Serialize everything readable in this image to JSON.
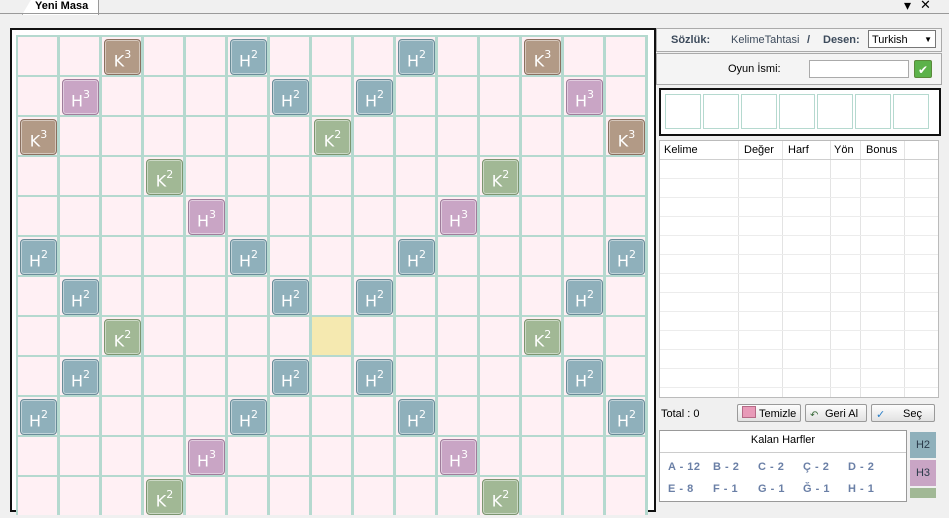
{
  "window": {
    "tab_title": "Yeni Masa",
    "menu_arrow": "▾",
    "close": "✕"
  },
  "board": {
    "size": 15,
    "center": [
      7,
      7
    ],
    "bonuses": [
      {
        "r": 0,
        "c": 2,
        "t": "K",
        "n": "3"
      },
      {
        "r": 0,
        "c": 5,
        "t": "H",
        "n": "2"
      },
      {
        "r": 0,
        "c": 9,
        "t": "H",
        "n": "2"
      },
      {
        "r": 0,
        "c": 12,
        "t": "K",
        "n": "3"
      },
      {
        "r": 1,
        "c": 1,
        "t": "H",
        "n": "3"
      },
      {
        "r": 1,
        "c": 6,
        "t": "H",
        "n": "2"
      },
      {
        "r": 1,
        "c": 8,
        "t": "H",
        "n": "2"
      },
      {
        "r": 1,
        "c": 13,
        "t": "H",
        "n": "3"
      },
      {
        "r": 2,
        "c": 0,
        "t": "K",
        "n": "3"
      },
      {
        "r": 2,
        "c": 7,
        "t": "K",
        "n": "2"
      },
      {
        "r": 2,
        "c": 14,
        "t": "K",
        "n": "3"
      },
      {
        "r": 3,
        "c": 3,
        "t": "K",
        "n": "2"
      },
      {
        "r": 3,
        "c": 11,
        "t": "K",
        "n": "2"
      },
      {
        "r": 4,
        "c": 4,
        "t": "H",
        "n": "3"
      },
      {
        "r": 4,
        "c": 10,
        "t": "H",
        "n": "3"
      },
      {
        "r": 5,
        "c": 0,
        "t": "H",
        "n": "2"
      },
      {
        "r": 5,
        "c": 5,
        "t": "H",
        "n": "2"
      },
      {
        "r": 5,
        "c": 9,
        "t": "H",
        "n": "2"
      },
      {
        "r": 5,
        "c": 14,
        "t": "H",
        "n": "2"
      },
      {
        "r": 6,
        "c": 1,
        "t": "H",
        "n": "2"
      },
      {
        "r": 6,
        "c": 6,
        "t": "H",
        "n": "2"
      },
      {
        "r": 6,
        "c": 8,
        "t": "H",
        "n": "2"
      },
      {
        "r": 6,
        "c": 13,
        "t": "H",
        "n": "2"
      },
      {
        "r": 7,
        "c": 2,
        "t": "K",
        "n": "2"
      },
      {
        "r": 7,
        "c": 12,
        "t": "K",
        "n": "2"
      },
      {
        "r": 8,
        "c": 1,
        "t": "H",
        "n": "2"
      },
      {
        "r": 8,
        "c": 6,
        "t": "H",
        "n": "2"
      },
      {
        "r": 8,
        "c": 8,
        "t": "H",
        "n": "2"
      },
      {
        "r": 8,
        "c": 13,
        "t": "H",
        "n": "2"
      },
      {
        "r": 9,
        "c": 0,
        "t": "H",
        "n": "2"
      },
      {
        "r": 9,
        "c": 5,
        "t": "H",
        "n": "2"
      },
      {
        "r": 9,
        "c": 9,
        "t": "H",
        "n": "2"
      },
      {
        "r": 9,
        "c": 14,
        "t": "H",
        "n": "2"
      },
      {
        "r": 10,
        "c": 4,
        "t": "H",
        "n": "3"
      },
      {
        "r": 10,
        "c": 10,
        "t": "H",
        "n": "3"
      },
      {
        "r": 11,
        "c": 3,
        "t": "K",
        "n": "2"
      },
      {
        "r": 11,
        "c": 11,
        "t": "K",
        "n": "2"
      }
    ]
  },
  "panel": {
    "dictionary_label": "Sözlük:",
    "dictionary_value": "KelimeTahtasi",
    "separator": "/",
    "pattern_label": "Desen:",
    "pattern_value": "Turkish",
    "game_name_label": "Oyun İsmi:",
    "game_name_value": "",
    "ok_icon": "✔",
    "rack_slots": 7,
    "columns": [
      "Kelime",
      "Değer",
      "Harf",
      "Yön",
      "Bonus"
    ],
    "total_label": "Total : 0",
    "buttons": {
      "clear": "Temizle",
      "undo": "Geri Al",
      "select": "Seç"
    },
    "remaining_title": "Kalan Harfler",
    "remaining_row1": [
      "A - 12",
      "B - 2",
      "C - 2",
      "Ç - 2",
      "D - 2"
    ],
    "remaining_row2": [
      "E - 8",
      "F - 1",
      "G - 1",
      "Ğ - 1",
      "H - 1"
    ],
    "legend": [
      "H2",
      "H3"
    ]
  },
  "colors": {
    "K3": "#b29a86",
    "H2": "#8fb0bb",
    "H3": "#c9a5c5",
    "K2": "#a1b895",
    "cell": "#fff0f4",
    "center": "#f5e9b0",
    "grid": "#b5d9cf"
  }
}
